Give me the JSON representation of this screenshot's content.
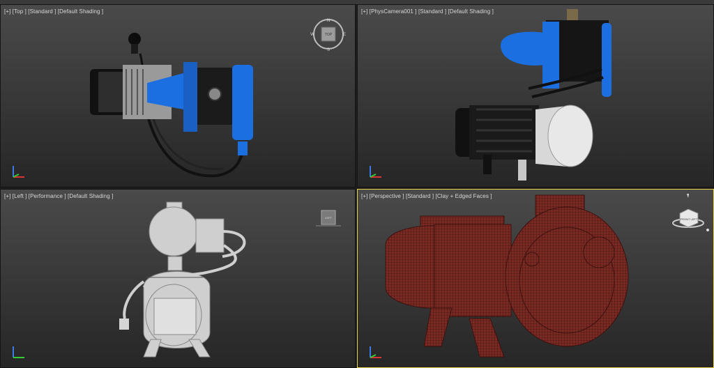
{
  "viewports": [
    {
      "id": "top",
      "label": {
        "plus": "[+]",
        "view": "[Top ]",
        "style": "[Standard ]",
        "shading": "[Default Shading ]"
      },
      "viewcube": {
        "n": "N",
        "s": "S",
        "w": "W",
        "e": "E",
        "face": "TOP"
      }
    },
    {
      "id": "physcamera",
      "label": {
        "plus": "[+]",
        "view": "[PhysCamera001 ]",
        "style": "[Standard ]",
        "shading": "[Default Shading ]"
      }
    },
    {
      "id": "left",
      "label": {
        "plus": "[+]",
        "view": "[Left ]",
        "style": "[Performance ]",
        "shading": "[Default Shading ]"
      },
      "viewcube": {
        "face": "LEFT"
      }
    },
    {
      "id": "perspective",
      "active": true,
      "label": {
        "plus": "[+]",
        "view": "[Perspective ]",
        "style": "[Standard ]",
        "shading": "[Clay + Edged Faces ]"
      },
      "viewcube": {
        "face": "FRONT LEFT"
      }
    }
  ],
  "colors": {
    "viewport_bg_top": "#4a4a4a",
    "viewport_bg_bottom": "#262626",
    "active_border": "#e6d44a",
    "pump_blue": "#1c6fe0",
    "clay_red": "#7a2a22"
  }
}
